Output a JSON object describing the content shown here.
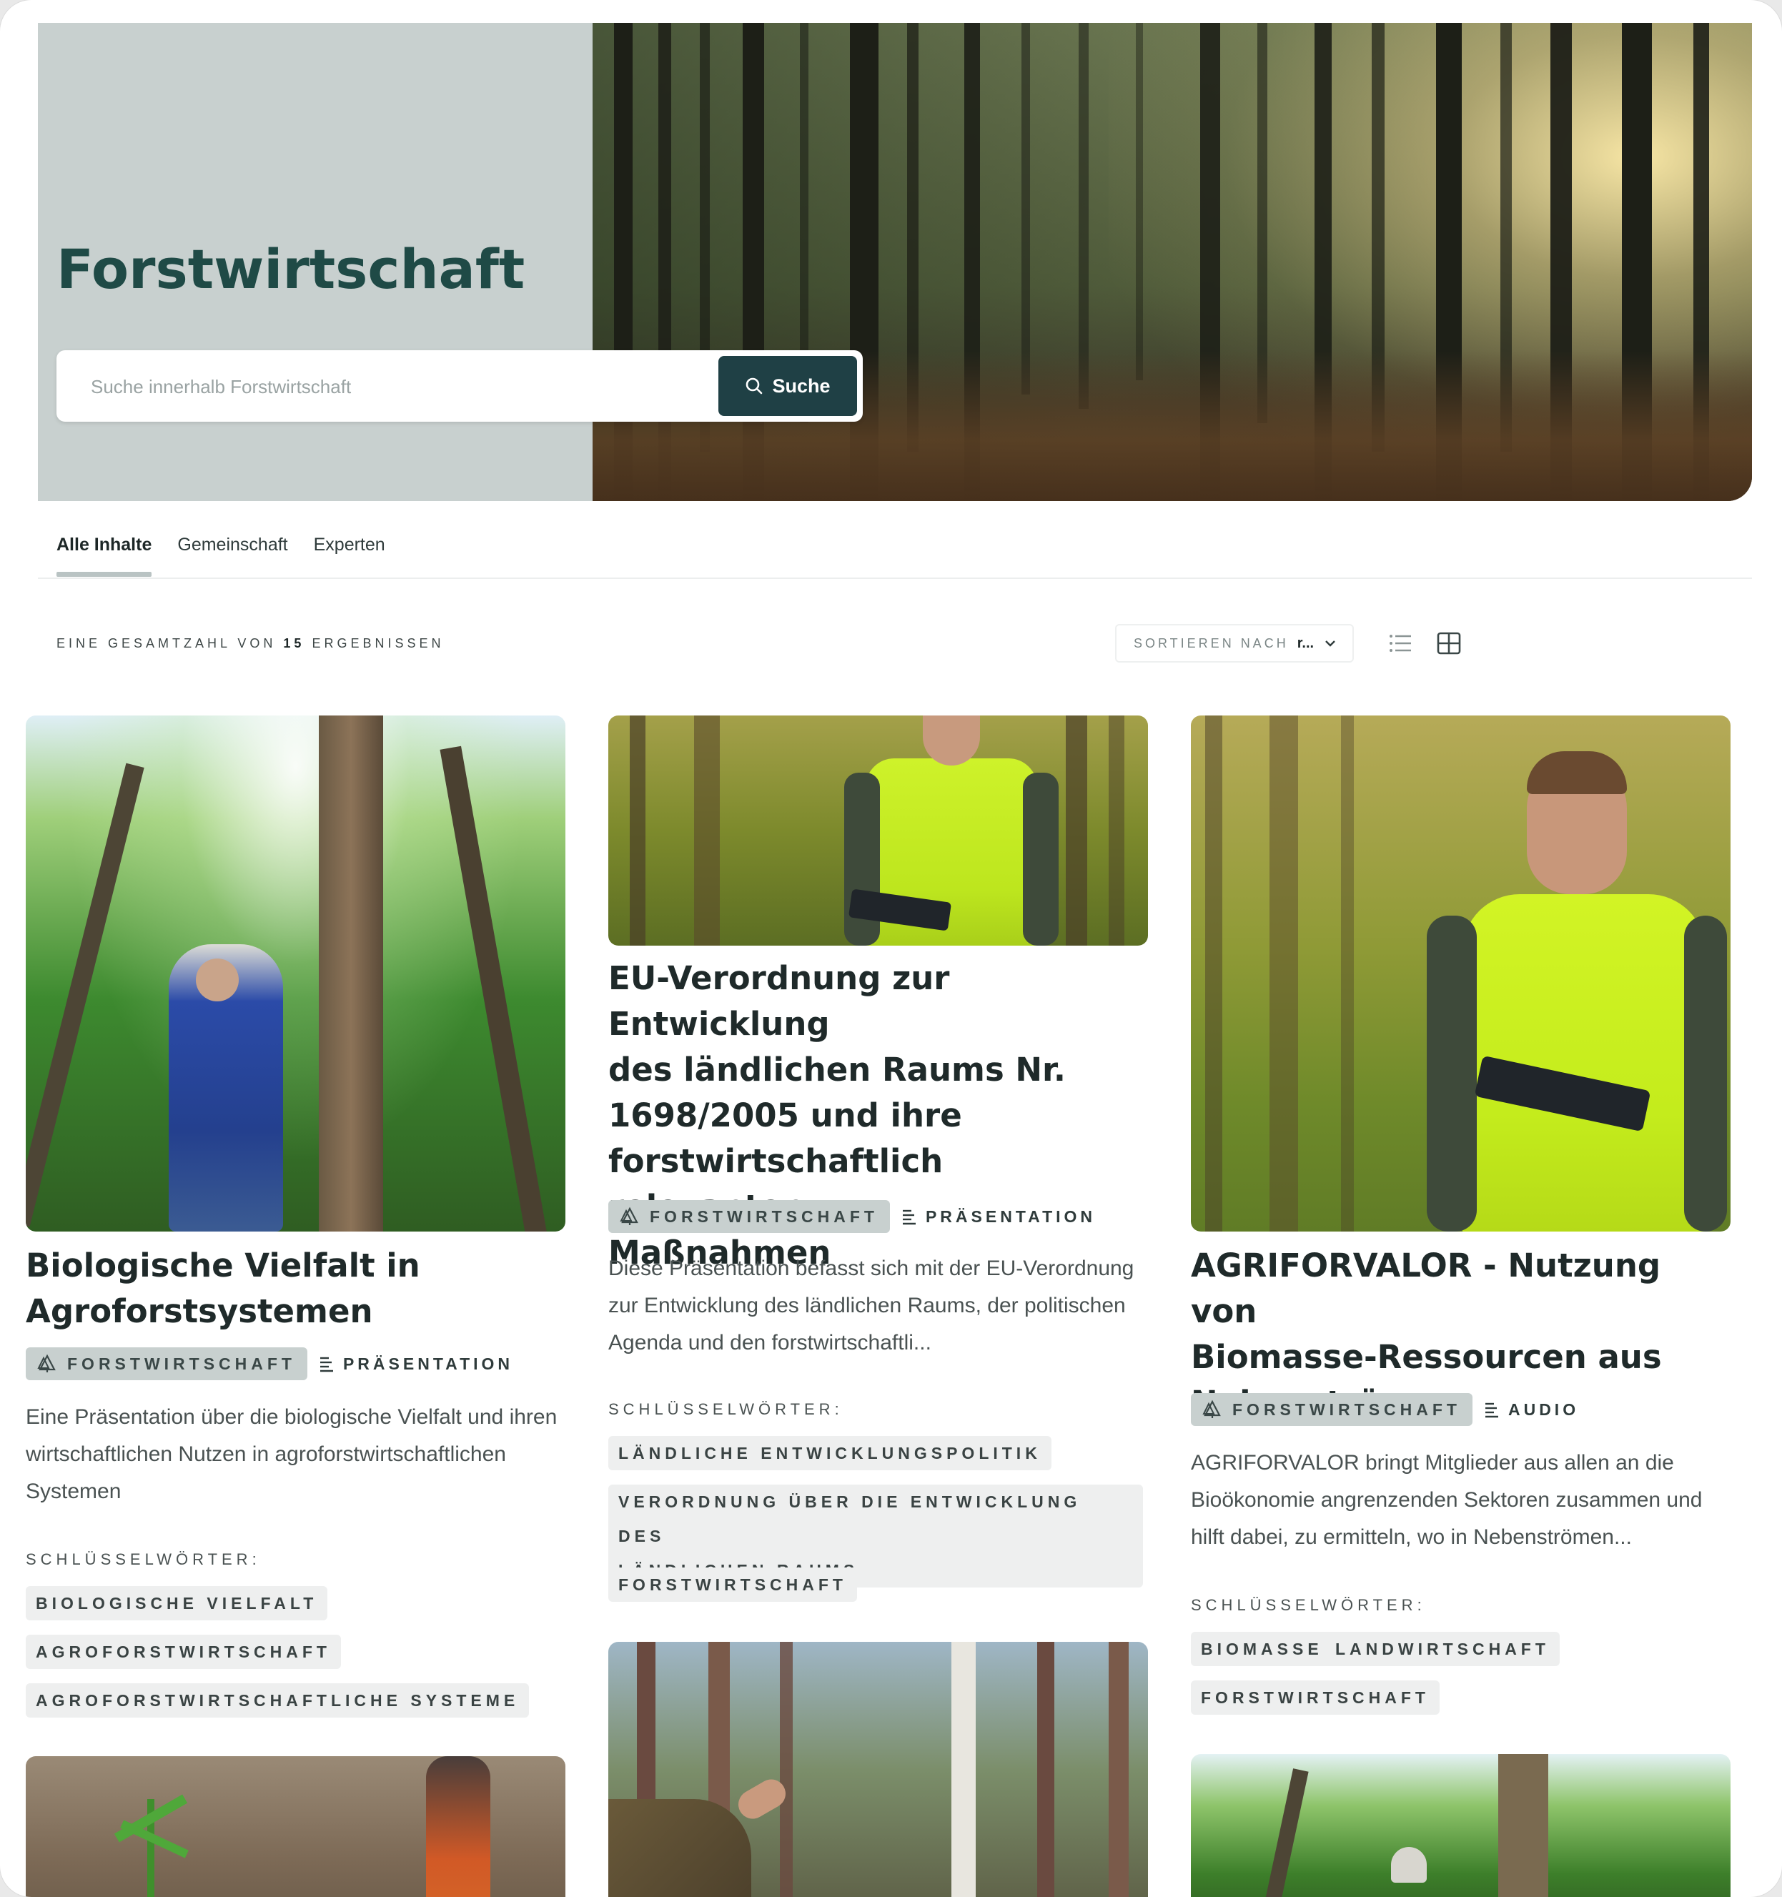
{
  "hero": {
    "title": "Forstwirtschaft",
    "search_placeholder": "Suche innerhalb Forstwirtschaft",
    "search_button": "Suche"
  },
  "tabs": [
    {
      "label": "Alle Inhalte",
      "active": true
    },
    {
      "label": "Gemeinschaft",
      "active": false
    },
    {
      "label": "Experten",
      "active": false
    }
  ],
  "results": {
    "prefix": "EINE GESAMTZAHL VON",
    "count": "15",
    "suffix": "ERGEBNISSEN"
  },
  "sort": {
    "label": "SORTIEREN NACH",
    "value": "r..."
  },
  "keywords_label": "SCHLÜSSELWÖRTER:",
  "cards": [
    {
      "title_lines": [
        "Biologische Vielfalt in",
        "Agroforstsystemen"
      ],
      "topic": "FORSTWIRTSCHAFT",
      "type": "PRÄSENTATION",
      "description_lines": [
        "Eine Präsentation über die biologische Vielfalt und ihren",
        "wirtschaftlichen Nutzen in agroforstwirtschaftlichen",
        "Systemen"
      ],
      "keywords": [
        "BIOLOGISCHE VIELFALT",
        "AGROFORSTWIRTSCHAFT",
        "AGROFORSTWIRTSCHAFTLICHE SYSTEME"
      ]
    },
    {
      "title_lines": [
        "EU-Verordnung zur Entwicklung",
        "des ländlichen Raums Nr.",
        "1698/2005 und ihre",
        "forstwirtschaftlich relevanten",
        "Maßnahmen"
      ],
      "topic": "FORSTWIRTSCHAFT",
      "type": "PRÄSENTATION",
      "description_lines": [
        "Diese Präsentation befasst sich mit der EU-Verordnung",
        "zur Entwicklung des ländlichen Raums, der politischen",
        "Agenda und den forstwirtschaftli..."
      ],
      "keywords": [
        "LÄNDLICHE ENTWICKLUNGSPOLITIK",
        "VERORDNUNG ÜBER DIE ENTWICKLUNG DES",
        "LÄNDLICHEN RAUMS",
        "FORSTWIRTSCHAFT"
      ]
    },
    {
      "title_lines": [
        "AGRIFORVALOR - Nutzung von",
        "Biomasse-Ressourcen aus",
        "Nebenströmen"
      ],
      "topic": "FORSTWIRTSCHAFT",
      "type": "AUDIO",
      "description_lines": [
        "AGRIFORVALOR bringt Mitglieder aus allen an die",
        "Bioökonomie angrenzenden Sektoren zusammen und",
        "hilft dabei, zu ermitteln, wo in Nebenströmen..."
      ],
      "keywords": [
        "BIOMASSE",
        "LANDWIRTSCHAFT",
        "FORSTWIRTSCHAFT"
      ]
    }
  ],
  "colors": {
    "brand_dark": "#1f4045",
    "title_green": "#1f4a46",
    "hero_panel": "#c8d0cf",
    "chip_bg": "#c8d0cf",
    "tag_bg": "#eeefef"
  },
  "icons": [
    "search-icon",
    "tree-icon",
    "document-lines-icon",
    "chevron-down-icon",
    "list-view-icon",
    "grid-view-icon"
  ]
}
